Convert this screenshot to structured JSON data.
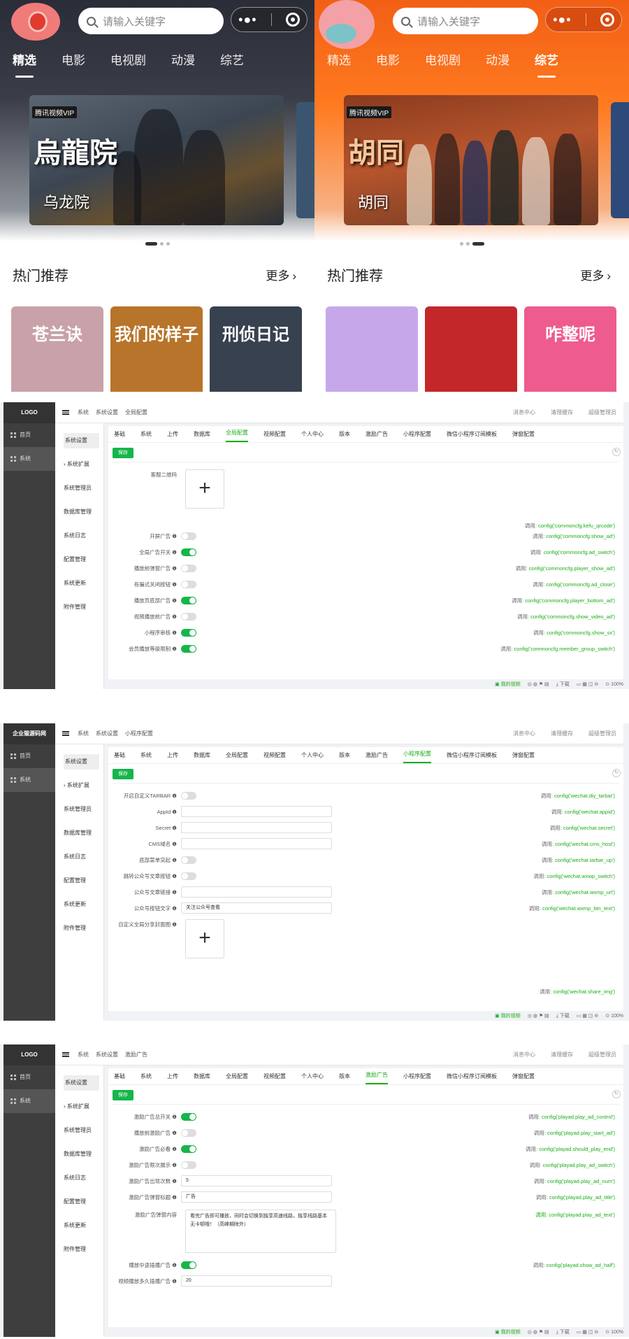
{
  "mobile_left": {
    "search_placeholder": "请输入关键字",
    "tabs": [
      "精选",
      "电影",
      "电视剧",
      "动漫",
      "综艺"
    ],
    "active_tab": 0,
    "banner_title_art": "烏龍院",
    "banner_subtitle": "乌龙院",
    "badge": "腾讯视频VIP",
    "section_title": "热门推荐",
    "more": "更多",
    "cards": [
      {
        "title": "苍兰诀",
        "bg": "#c8a2a8"
      },
      {
        "title": "我们的样子",
        "bg": "#b8742a"
      },
      {
        "title": "刑侦日记",
        "bg": "#37414f"
      }
    ]
  },
  "mobile_right": {
    "search_placeholder": "请输入关键字",
    "tabs": [
      "精选",
      "电影",
      "电视剧",
      "动漫",
      "综艺"
    ],
    "active_tab": 4,
    "banner_title_art": "胡同",
    "banner_subtitle": "胡同",
    "badge": "腾讯视频VIP",
    "section_title": "热门推荐",
    "more": "更多",
    "cards": [
      {
        "title": "",
        "bg": "#c6a8ea"
      },
      {
        "title": "",
        "bg": "#c3272a"
      },
      {
        "title": "咋整呢",
        "bg": "#ee5b8e"
      }
    ]
  },
  "admin_nav": {
    "logo": "LOGO",
    "logo2": "企业猫源码网",
    "items": [
      "首页",
      "系统"
    ],
    "sub_items": [
      "系统设置",
      "系统扩展",
      "系统管理员",
      "数据库管理",
      "系统日志",
      "配置管理",
      "系统更新",
      "附件管理"
    ],
    "top_right": [
      "消息中心",
      "清理缓存",
      "超级管理员"
    ],
    "tabs": [
      "基础",
      "系统",
      "上传",
      "数据库",
      "全局配置",
      "视频配置",
      "个人中心",
      "版本",
      "激励广告",
      "小程序配置",
      "微信小程序订阅模板",
      "弹窗配置"
    ],
    "save": "保存",
    "status_items": [
      "我的视频",
      "下载",
      "100%"
    ]
  },
  "panel1": {
    "crumbs": [
      "系统",
      "系统设置",
      "全局配置"
    ],
    "active_tab": 4,
    "qr_label": "客服二维码",
    "rows": [
      {
        "label": "开屏广告",
        "type": "toggle",
        "on": false,
        "call": "config('commoncfg.show_ad')"
      },
      {
        "label": "全局广告开关",
        "type": "toggle",
        "on": true,
        "call": "config('commoncfg.ad_switch')"
      },
      {
        "label": "播放前弹窗广告",
        "type": "toggle",
        "on": false,
        "call": "config('commoncfg.player_show_ad')"
      },
      {
        "label": "有骗式关闭按钮",
        "type": "toggle",
        "on": false,
        "call": "config('commoncfg.ad_close')"
      },
      {
        "label": "播放页底部广告",
        "type": "toggle",
        "on": true,
        "call": "config('commoncfg.player_bottom_ad')"
      },
      {
        "label": "视频播放前广告",
        "type": "toggle",
        "on": false,
        "call": "config('commoncfg.show_video_ad')"
      },
      {
        "label": "小程序审核",
        "type": "toggle",
        "on": true,
        "call": "config('commoncfg.show_sx')"
      },
      {
        "label": "会员播放等级限制",
        "type": "toggle",
        "on": true,
        "call": "config('commoncfg.member_group_switch')"
      }
    ],
    "qr_call": "config('commoncfg.kefu_qrcode')",
    "call_prefix": "调用:"
  },
  "panel2": {
    "crumbs": [
      "系统",
      "系统设置",
      "小程序配置"
    ],
    "active_tab": 9,
    "rows": [
      {
        "label": "开启自定义TARBAR",
        "type": "toggle",
        "on": false,
        "call": "config('wechat.diy_tarbar')"
      },
      {
        "label": "AppId",
        "type": "input",
        "value": "",
        "call": "config('wechat.appid')"
      },
      {
        "label": "Secret",
        "type": "input",
        "value": "",
        "call": "config('wechat.secret')"
      },
      {
        "label": "CMS域名",
        "type": "input",
        "value": "",
        "call": "config('wechat.cms_host')"
      },
      {
        "label": "底部菜单突起",
        "type": "toggle",
        "on": false,
        "call": "config('wechat.tarbar_up')"
      },
      {
        "label": "跳转公众号文章按钮",
        "type": "toggle",
        "on": false,
        "call": "config('wechat.wxwp_switch')"
      },
      {
        "label": "公众号文章链接",
        "type": "input",
        "value": "",
        "call": "config('wechat.wxmp_url')"
      },
      {
        "label": "公众号按钮文字",
        "type": "input",
        "value": "关注公众号查看",
        "call": "config('wechat.wxmp_btn_text')"
      }
    ],
    "img_label": "自定义全局分享封面图",
    "img_call": "config('wechat.share_img')"
  },
  "panel3": {
    "crumbs": [
      "系统",
      "系统设置",
      "激励广告"
    ],
    "active_tab": 8,
    "rows": [
      {
        "label": "激励广告总开关",
        "type": "toggle",
        "on": true,
        "call": "config('playad.play_ad_control')"
      },
      {
        "label": "播放前激励广告",
        "type": "toggle",
        "on": false,
        "call": "config('playad.play_start_ad')"
      },
      {
        "label": "激励广告必看",
        "type": "toggle",
        "on": true,
        "call": "config('playad.should_play_end')"
      },
      {
        "label": "激励广告限次展示",
        "type": "toggle",
        "on": false,
        "call": "config('playad.play_ad_switch')"
      },
      {
        "label": "激励广告出现次数",
        "type": "input",
        "value": "5",
        "call": "config('playad.play_ad_num')"
      },
      {
        "label": "激励广告弹窗标题",
        "type": "input",
        "value": "广告",
        "call": "config('playad.play_ad_title')"
      }
    ],
    "text_label": "激励广告弹窗内容",
    "text_value": "看完广告即可播放，同时会切换到独享高速线路，独享线路基本无卡顿哦！（高峰期除外）",
    "text_call": "config('playad.play_ad_text')",
    "half_label": "播放中途插播广告",
    "half_call": "config('playad.show_ad_half')",
    "last_label": "视频播放多久插播广告",
    "last_value": "20"
  },
  "colors": {
    "accent": "#16b54b",
    "orange": "#ff7a1f",
    "sidebar": "#3e3e3e"
  }
}
